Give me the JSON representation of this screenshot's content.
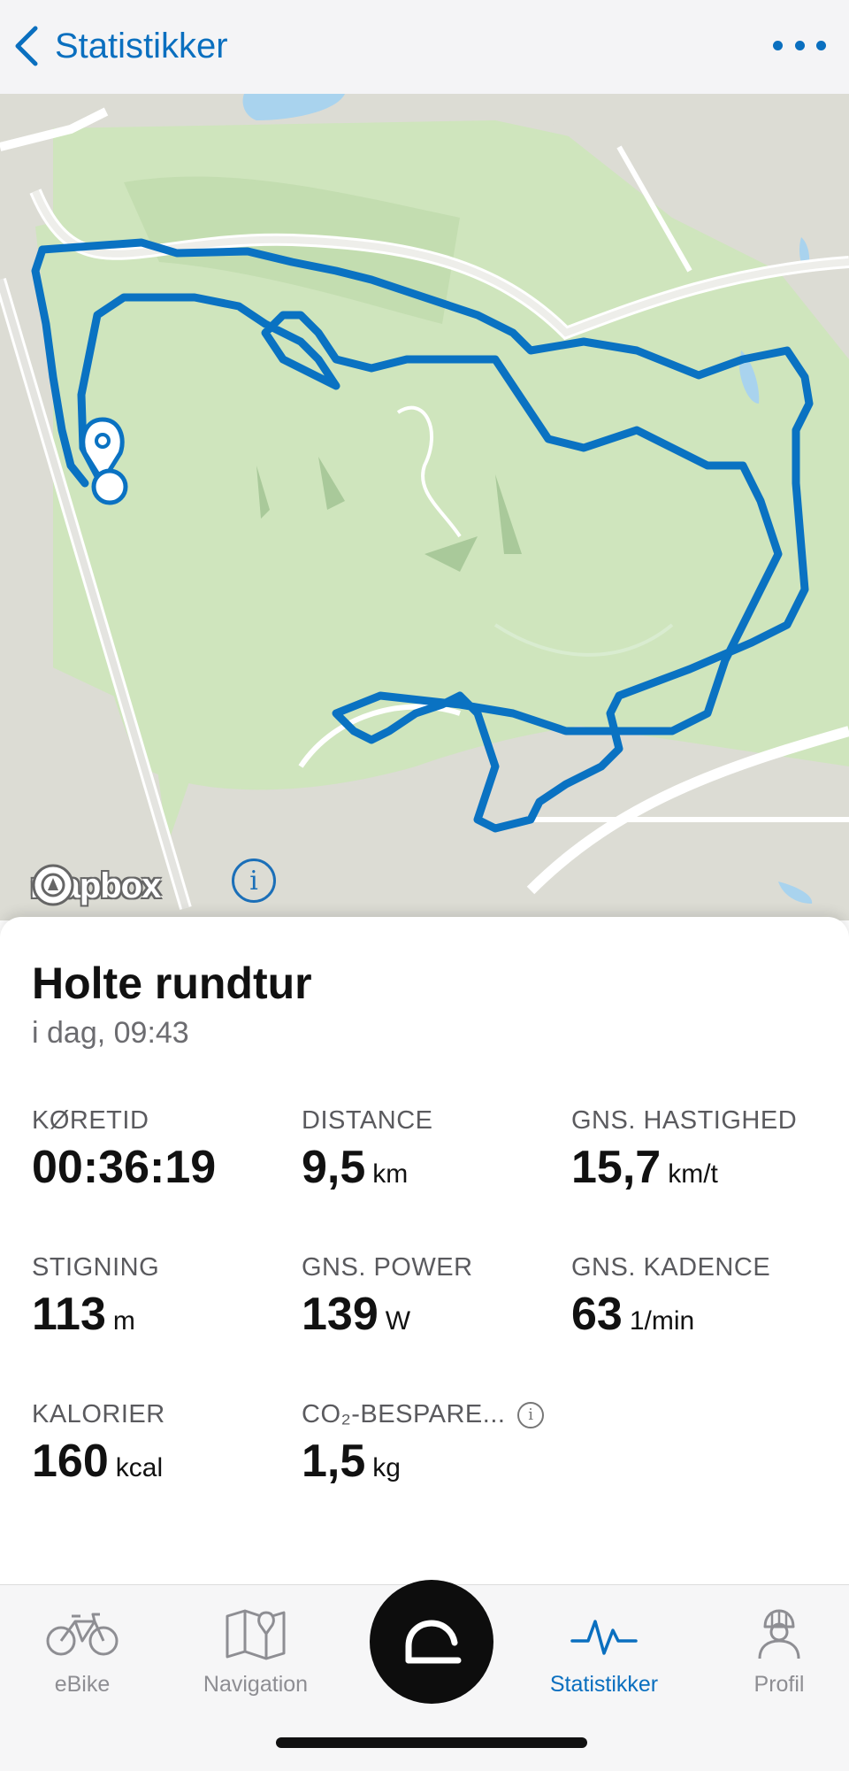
{
  "header": {
    "title": "Statistikker"
  },
  "map": {
    "attribution": "mapbox"
  },
  "ride": {
    "title": "Holte rundtur",
    "date": "i dag, 09:43"
  },
  "stats": {
    "ride_time": {
      "label": "KØRETID",
      "value": "00:36:19",
      "unit": ""
    },
    "distance": {
      "label": "DISTANCE",
      "value": "9,5",
      "unit": "km"
    },
    "avg_speed": {
      "label": "GNS. HASTIGHED",
      "value": "15,7",
      "unit": "km/t"
    },
    "elevation": {
      "label": "STIGNING",
      "value": "113",
      "unit": "m"
    },
    "avg_power": {
      "label": "GNS. POWER",
      "value": "139",
      "unit": "W"
    },
    "avg_cadence": {
      "label": "GNS. KADENCE",
      "value": "63",
      "unit": "1/min"
    },
    "calories": {
      "label": "KALORIER",
      "value": "160",
      "unit": "kcal"
    },
    "co2": {
      "label": "CO₂-BESPARE...",
      "value": "1,5",
      "unit": "kg"
    }
  },
  "tabs": [
    {
      "label": "eBike",
      "icon": "bike-icon",
      "active": false
    },
    {
      "label": "Navigation",
      "icon": "map-icon",
      "active": false
    },
    {
      "label": "Statistikker",
      "icon": "activity-icon",
      "active": true
    },
    {
      "label": "Profil",
      "icon": "profile-icon",
      "active": false
    }
  ],
  "colors": {
    "accent": "#0a6fbf",
    "route": "#0a72c2",
    "park": "#cfe5bd",
    "urban": "#dcdcd4"
  }
}
